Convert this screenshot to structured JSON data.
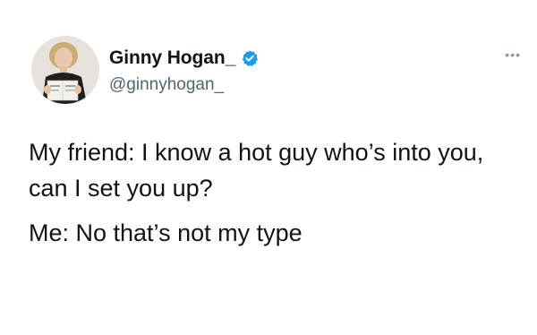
{
  "tweet": {
    "display_name": "Ginny Hogan_",
    "handle": "@ginnyhogan_",
    "verified": true,
    "verified_color": "#1d9bf0",
    "more_icon": "ellipsis-icon",
    "lines": [
      "My friend: I know a hot guy who’s into you, can I set you up?",
      "Me: No that’s not my type"
    ]
  }
}
